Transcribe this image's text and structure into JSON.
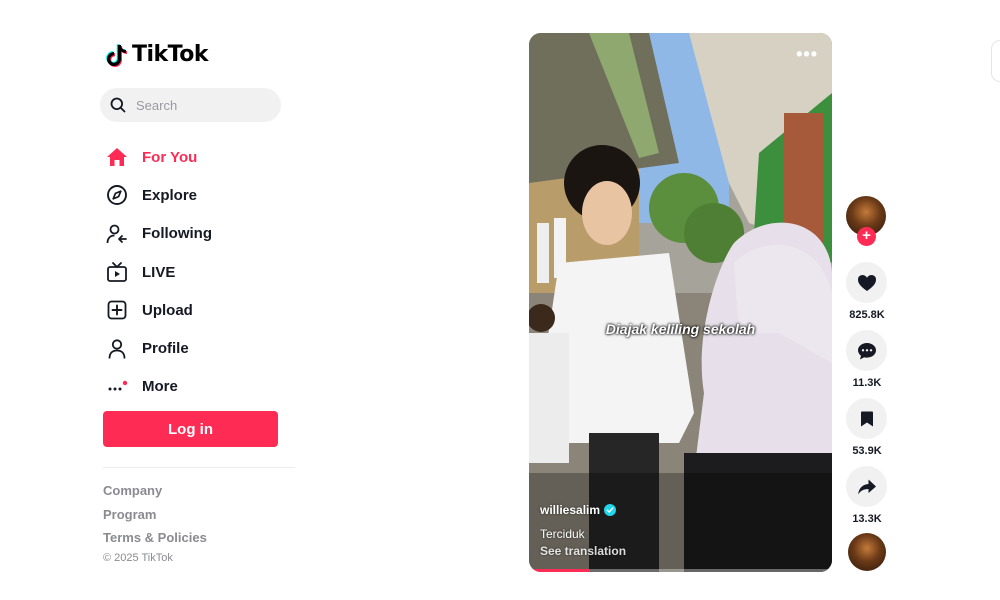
{
  "brand": {
    "name": "TikTok"
  },
  "search": {
    "placeholder": "Search"
  },
  "nav": {
    "items": [
      {
        "label": "For You",
        "icon": "home-icon",
        "active": true
      },
      {
        "label": "Explore",
        "icon": "compass-icon"
      },
      {
        "label": "Following",
        "icon": "following-icon"
      },
      {
        "label": "LIVE",
        "icon": "live-tv-icon"
      },
      {
        "label": "Upload",
        "icon": "upload-plus-icon"
      },
      {
        "label": "Profile",
        "icon": "profile-icon"
      },
      {
        "label": "More",
        "icon": "more-dots-icon"
      }
    ]
  },
  "login": {
    "label": "Log in"
  },
  "footer": {
    "links": [
      "Company",
      "Program",
      "Terms & Policies"
    ],
    "copyright": "© 2025 TikTok"
  },
  "video": {
    "overlay_text": "Diajak keliling sekolah",
    "author": "williesalim",
    "description": "Terciduk",
    "translate_label": "See translation",
    "progress": 0.2
  },
  "actions": {
    "likes": "825.8K",
    "comments": "11.3K",
    "saves": "53.9K",
    "shares": "13.3K"
  },
  "colors": {
    "accent": "#fe2c55",
    "text": "#161823",
    "muted": "#8a8b91",
    "verified": "#20d5ec"
  }
}
